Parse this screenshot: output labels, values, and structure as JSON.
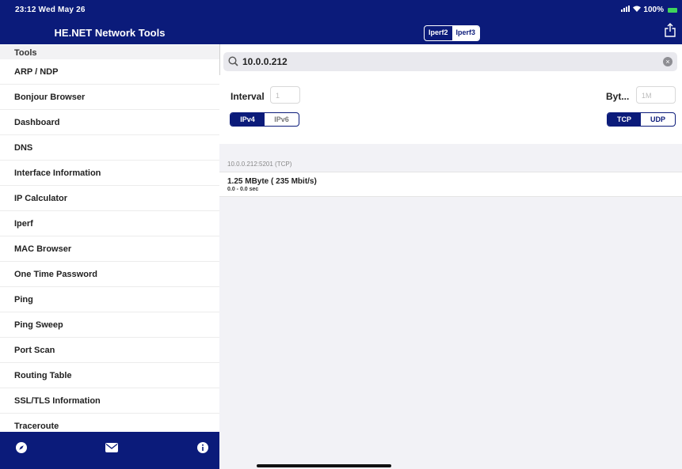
{
  "status": {
    "time": "23:12  Wed May 26",
    "right": "100%"
  },
  "sidebar": {
    "title": "HE.NET Network Tools",
    "section": "Tools",
    "items": [
      {
        "label": "ARP / NDP"
      },
      {
        "label": "Bonjour Browser"
      },
      {
        "label": "Dashboard"
      },
      {
        "label": "DNS"
      },
      {
        "label": "Interface Information"
      },
      {
        "label": "IP Calculator"
      },
      {
        "label": "Iperf"
      },
      {
        "label": "MAC Browser"
      },
      {
        "label": "One Time Password"
      },
      {
        "label": "Ping"
      },
      {
        "label": "Ping Sweep"
      },
      {
        "label": "Port Scan"
      },
      {
        "label": "Routing Table"
      },
      {
        "label": "SSL/TLS Information"
      },
      {
        "label": "Traceroute"
      }
    ],
    "footer_icons": [
      "compass-icon",
      "mail-icon",
      "info-icon"
    ]
  },
  "header": {
    "segments": [
      {
        "label": "Iperf2",
        "active": false
      },
      {
        "label": "Iperf3",
        "active": true
      }
    ],
    "share_icon": "share-icon"
  },
  "search": {
    "value": "10.0.0.212"
  },
  "settings": {
    "interval_label": "Interval",
    "interval_placeholder": "1",
    "bytes_label": "Byt...",
    "bytes_placeholder": "1M",
    "ip_options": [
      "IPv4",
      "IPv6"
    ],
    "ip_selected": "IPv4",
    "proto_options": [
      "TCP",
      "UDP"
    ],
    "proto_selected": "TCP"
  },
  "results": {
    "header": "10.0.0.212:5201 (TCP)",
    "rows": [
      {
        "main": "1.25 MByte ( 235 Mbit/s)",
        "sub": "0.0 - 0.0 sec"
      }
    ]
  },
  "colors": {
    "accent": "#0b1b7a",
    "battery": "#3fd45b"
  }
}
